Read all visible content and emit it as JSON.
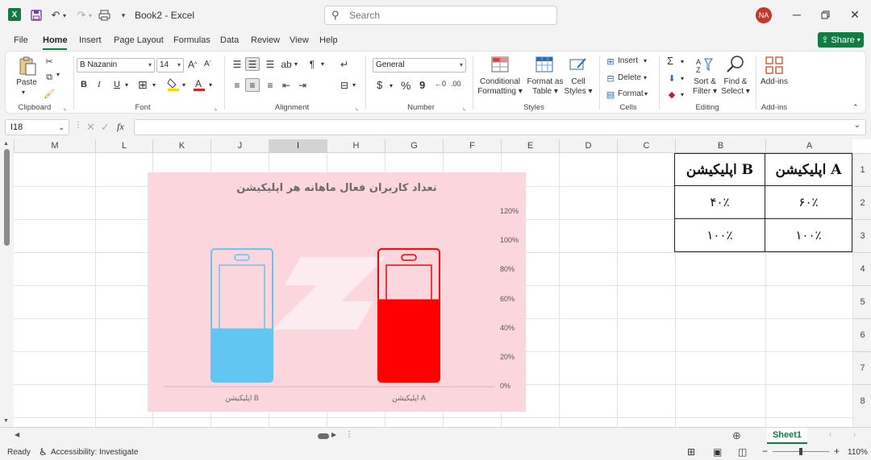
{
  "titlebar": {
    "app_logo": "X",
    "doc_title": "Book2  -  Excel",
    "search_placeholder": "Search",
    "avatar_initials": "NA"
  },
  "menu": {
    "tabs": [
      "File",
      "Home",
      "Insert",
      "Page Layout",
      "Formulas",
      "Data",
      "Review",
      "View",
      "Help"
    ],
    "share_label": "Share"
  },
  "ribbon": {
    "clipboard": {
      "paste": "Paste",
      "label": "Clipboard"
    },
    "font": {
      "name": "B Nazanin",
      "size": "14",
      "label": "Font",
      "grow": "A",
      "shrink": "A",
      "bold": "B",
      "italic": "I",
      "underline": "U"
    },
    "alignment": {
      "label": "Alignment"
    },
    "number": {
      "format": "General",
      "label": "Number",
      "currency": "$",
      "percent": "%",
      "comma": "9"
    },
    "styles": {
      "conditional": [
        "Conditional",
        "Formatting"
      ],
      "format_table": [
        "Format as",
        "Table"
      ],
      "cell_styles": [
        "Cell",
        "Styles"
      ],
      "label": "Styles"
    },
    "cells": {
      "insert": "Insert",
      "delete": "Delete",
      "format": "Format",
      "label": "Cells"
    },
    "editing": {
      "sort": [
        "Sort &",
        "Filter"
      ],
      "find": [
        "Find &",
        "Select"
      ],
      "label": "Editing",
      "sum": "Σ"
    },
    "addins": {
      "addins": "Add-ins",
      "label": "Add-ins"
    }
  },
  "formulabar": {
    "namebox": "I18",
    "fx": "fx"
  },
  "columns": [
    {
      "name": "M",
      "left": 0
    },
    {
      "name": "L",
      "left": 0
    },
    {
      "name": "K",
      "left": 0
    },
    {
      "name": "J",
      "left": 0
    },
    {
      "name": "I",
      "left": 0
    },
    {
      "name": "H",
      "left": 0
    },
    {
      "name": "G",
      "left": 0
    },
    {
      "name": "F",
      "left": 0
    },
    {
      "name": "E",
      "left": 0
    },
    {
      "name": "D",
      "left": 0
    },
    {
      "name": "C",
      "left": 0
    },
    {
      "name": "B",
      "left": 0
    },
    {
      "name": "A",
      "left": 0
    }
  ],
  "rows": [
    "1",
    "2",
    "3",
    "4",
    "5",
    "6",
    "7",
    "8"
  ],
  "table": {
    "head_a": "اپلیکیشن A",
    "head_b": "اپلیکیشن B",
    "a1": "۶۰٪",
    "b1": "۴۰٪",
    "a2": "۱۰۰٪",
    "b2": "۱۰۰٪"
  },
  "chart_data": {
    "type": "bar",
    "title": "تعداد کاربران فعال ماهانه هر اپلیکیشن",
    "categories": [
      "اپلیکیشن B",
      "اپلیکیشن A"
    ],
    "series": [
      {
        "values": [
          40,
          60
        ],
        "colors": [
          "#63c6f2",
          "#ff0000"
        ]
      },
      {
        "values": [
          100,
          100
        ]
      }
    ],
    "y_ticks": [
      "120%",
      "100%",
      "80%",
      "60%",
      "40%",
      "20%",
      "0%"
    ],
    "ylim": [
      0,
      120
    ],
    "grid": false,
    "legend": "none"
  },
  "sheets": {
    "active": "Sheet1"
  },
  "status": {
    "ready": "Ready",
    "accessibility": "Accessibility: Investigate",
    "zoom": "110%"
  }
}
